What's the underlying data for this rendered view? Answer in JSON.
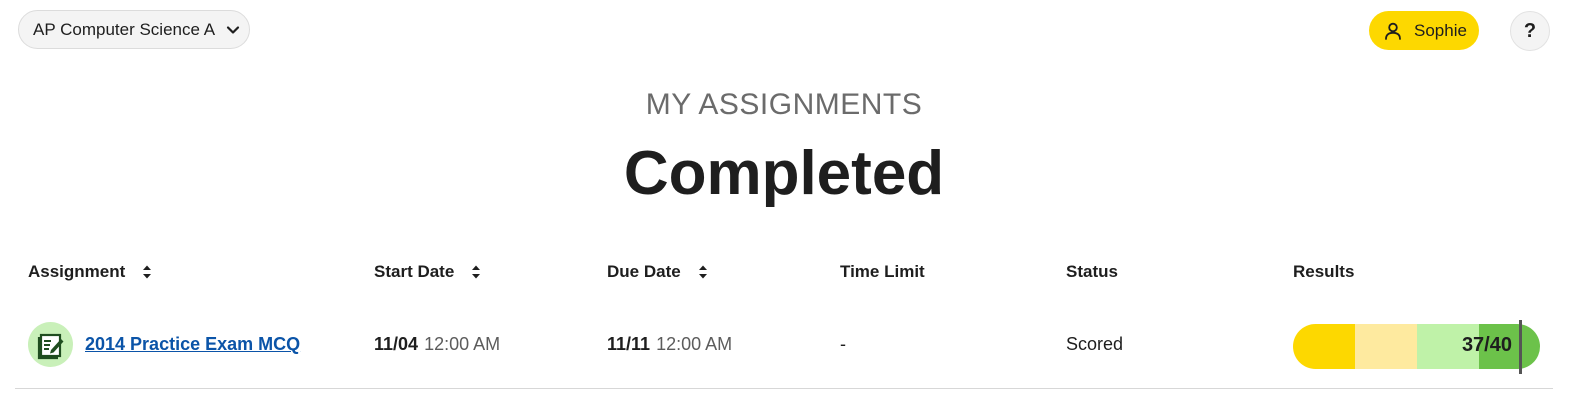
{
  "header": {
    "course_selector": {
      "label": "AP Computer Science A",
      "icon": "chevron-down-icon"
    },
    "user": {
      "name": "Sophie",
      "icon": "user-icon",
      "background": "#fdd800"
    },
    "help": {
      "label": "?"
    }
  },
  "page": {
    "eyebrow": "MY ASSIGNMENTS",
    "title": "Completed"
  },
  "table": {
    "columns": [
      {
        "label": "Assignment",
        "sortable": true
      },
      {
        "label": "Start Date",
        "sortable": true
      },
      {
        "label": "Due Date",
        "sortable": true
      },
      {
        "label": "Time Limit",
        "sortable": false
      },
      {
        "label": "Status",
        "sortable": false
      },
      {
        "label": "Results",
        "sortable": false
      }
    ],
    "rows": [
      {
        "assignment": "2014 Practice Exam MCQ",
        "icon": "assignment-edit-icon",
        "start_date": "11/04",
        "start_time": "12:00 AM",
        "due_date": "11/11",
        "due_time": "12:00 AM",
        "time_limit": "-",
        "status": "Scored",
        "results": {
          "score": "37/40",
          "segment_colors": [
            "#fdd800",
            "#feea9f",
            "#bff2a8",
            "#6cc24a"
          ]
        }
      }
    ]
  }
}
